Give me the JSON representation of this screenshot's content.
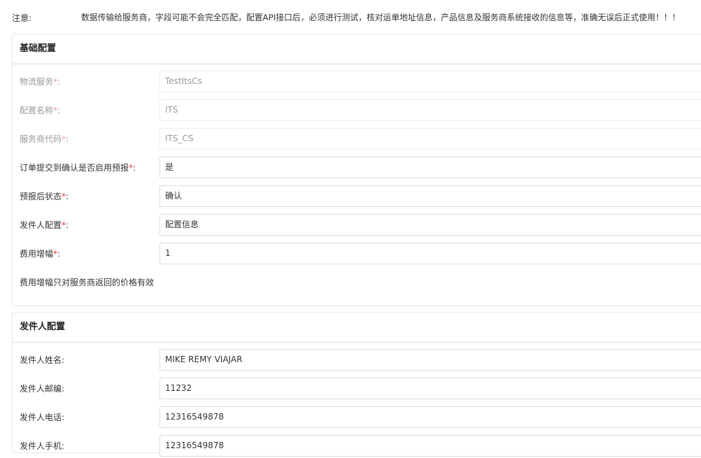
{
  "notice": {
    "label": "注意:",
    "text": "数据传输给服务商，字段可能不会完全匹配，配置API接口后，必须进行测试，核对运单地址信息，产品信息及服务商系统接收的信息等，准确无误后正式使用！！！"
  },
  "base_config": {
    "title": "基础配置",
    "fields": [
      {
        "label": "物流服务",
        "required_mark": "*",
        "colon": ":",
        "value": "TestItsCs",
        "disabled": true
      },
      {
        "label": "配置名称",
        "required_mark": "*",
        "colon": ":",
        "value": "ITS",
        "disabled": true
      },
      {
        "label": "服务商代码",
        "required_mark": "*",
        "colon": ":",
        "value": "ITS_CS",
        "disabled": true
      },
      {
        "label": "订单提交到确认是否启用预报",
        "required_mark": "*",
        "colon": ":",
        "value": "是",
        "disabled": false
      },
      {
        "label": "预报后状态",
        "required_mark": "*",
        "colon": ":",
        "value": "确认",
        "disabled": false
      },
      {
        "label": "发件人配置",
        "required_mark": "*",
        "colon": ":",
        "value": "配置信息",
        "disabled": false
      },
      {
        "label": "费用增幅",
        "required_mark": "*",
        "colon": ":",
        "value": "1",
        "disabled": false
      }
    ],
    "hint": "费用增幅只对服务商返回的价格有效"
  },
  "sender_config": {
    "title": "发件人配置",
    "fields": [
      {
        "label": "发件人姓名:",
        "value": "MIKE REMY VIAJAR"
      },
      {
        "label": "发件人邮编:",
        "value": "11232"
      },
      {
        "label": "发件人电话:",
        "value": "12316549878"
      },
      {
        "label": "发件人手机:",
        "value": "12316549878"
      }
    ]
  },
  "colors": {
    "required": "#e53935",
    "disabled_text": "#999999",
    "border": "#dcdcdc",
    "text": "#333333"
  }
}
